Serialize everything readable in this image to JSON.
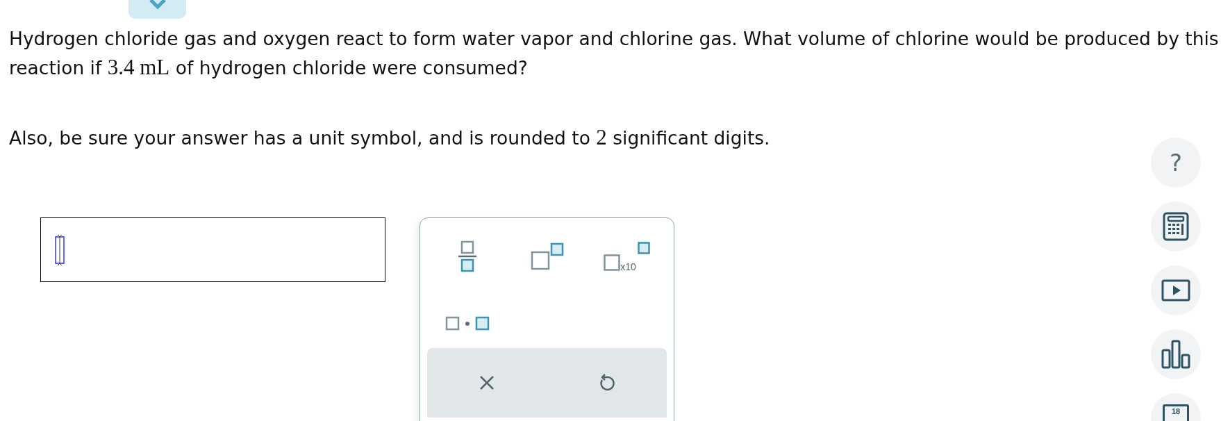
{
  "question": {
    "paragraphs": [
      [
        {
          "kind": "plain",
          "text": "Hydrogen chloride gas and oxygen react to form water vapor and chlorine gas. What volume of chlorine would be produced by this reaction if "
        },
        {
          "kind": "math",
          "text": "3.4 mL"
        },
        {
          "kind": "plain",
          "text": " of hydrogen chloride were consumed?"
        }
      ],
      [
        {
          "kind": "plain",
          "text": "Also, be sure your answer has a unit symbol, and is rounded to "
        },
        {
          "kind": "math",
          "text": "2"
        },
        {
          "kind": "plain",
          "text": " significant digits."
        }
      ]
    ]
  },
  "palette": {
    "templates": [
      {
        "kind": "fraction"
      },
      {
        "kind": "superscript"
      },
      {
        "kind": "sci",
        "text": "x10"
      },
      {
        "kind": "product"
      }
    ]
  },
  "side_tools": [
    {
      "kind": "help",
      "text": "?"
    },
    {
      "kind": "calculator"
    },
    {
      "kind": "video"
    },
    {
      "kind": "chart"
    },
    {
      "kind": "calendar",
      "text": "18"
    }
  ]
}
